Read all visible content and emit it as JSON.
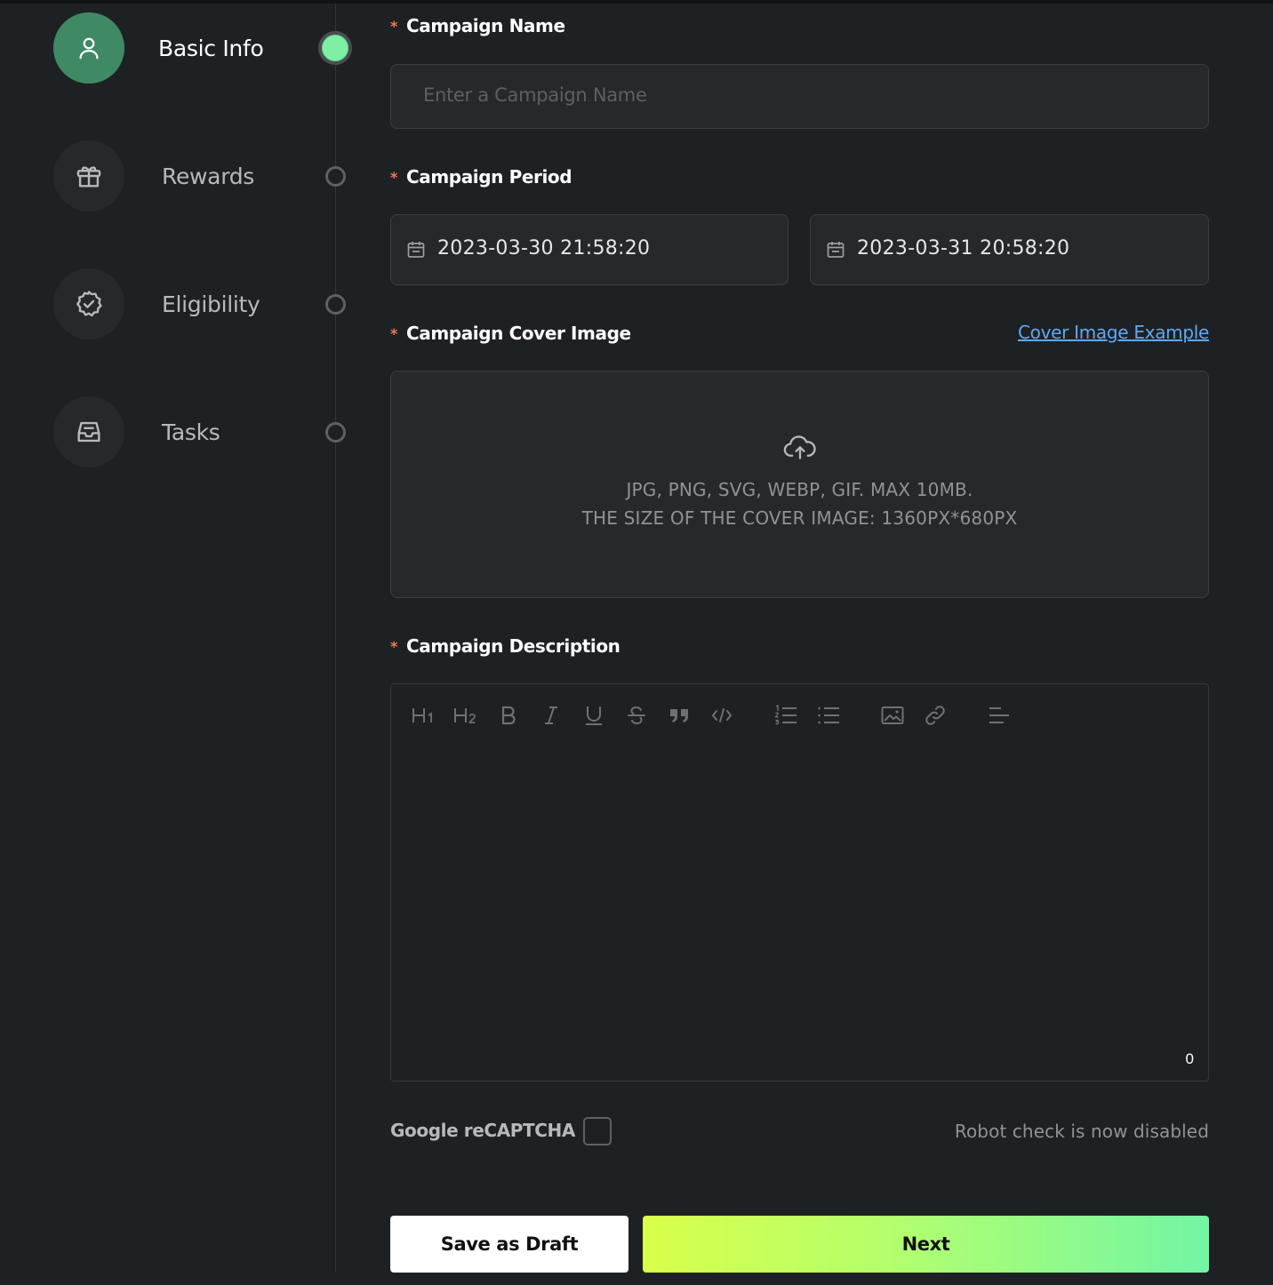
{
  "sidebar": {
    "steps": [
      {
        "label": "Basic Info",
        "icon": "user-icon",
        "active": true
      },
      {
        "label": "Rewards",
        "icon": "gift-icon",
        "active": false
      },
      {
        "label": "Eligibility",
        "icon": "verified-badge-icon",
        "active": false
      },
      {
        "label": "Tasks",
        "icon": "inbox-icon",
        "active": false
      }
    ]
  },
  "form": {
    "required_mark": "*",
    "campaign_name": {
      "label": "Campaign Name",
      "placeholder": "Enter a Campaign Name",
      "value": ""
    },
    "campaign_period": {
      "label": "Campaign Period",
      "start": "2023-03-30 21:58:20",
      "end": "2023-03-31 20:58:20"
    },
    "cover_image": {
      "label": "Campaign Cover Image",
      "example_link": "Cover Image Example",
      "formats": "JPG, PNG, SVG, WEBP, GIF. MAX 10MB.",
      "size_hint": "THE SIZE OF THE COVER IMAGE: 1360PX*680PX"
    },
    "description": {
      "label": "Campaign Description",
      "char_count": "0",
      "toolbar": [
        "H1",
        "H2",
        "B",
        "I",
        "U",
        "S",
        "quote-icon",
        "code-icon",
        "ordered-list-icon",
        "bullet-list-icon",
        "image-icon",
        "link-icon",
        "align-icon"
      ]
    },
    "captcha": {
      "label": "Google reCAPTCHA",
      "status": "Robot check is now disabled",
      "checked": false
    }
  },
  "actions": {
    "save_draft": "Save as Draft",
    "next": "Next"
  },
  "colors": {
    "accent_green": "#7ef0a5",
    "active_step_bg": "#3f8a65",
    "required": "#f07a52",
    "link": "#5fa8f5"
  }
}
